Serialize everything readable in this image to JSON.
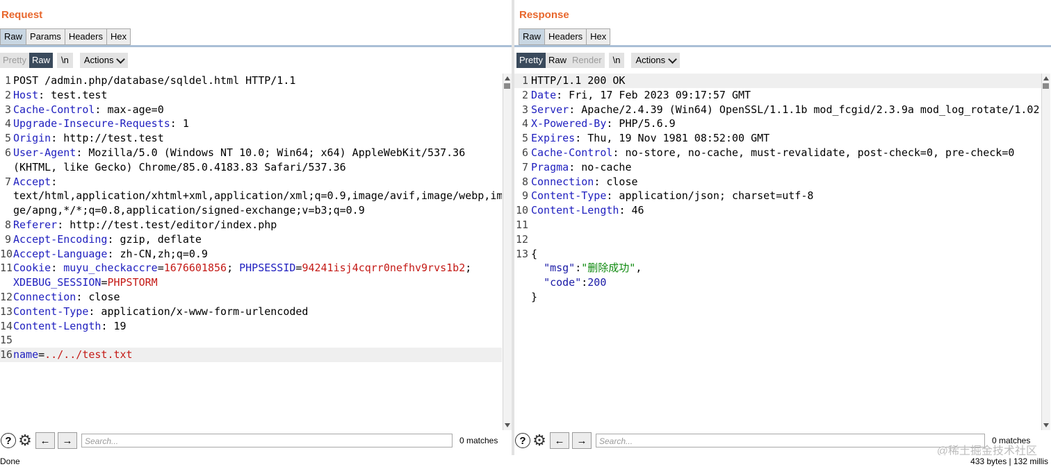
{
  "request": {
    "title": "Request",
    "tabs": [
      "Raw",
      "Params",
      "Headers",
      "Hex"
    ],
    "toolbar": {
      "pretty": "Pretty",
      "raw": "Raw",
      "newline": "\\n",
      "actions": "Actions"
    },
    "search": {
      "placeholder": "Search...",
      "matches": "0 matches"
    }
  },
  "response": {
    "title": "Response",
    "tabs": [
      "Raw",
      "Headers",
      "Hex"
    ],
    "toolbar": {
      "pretty": "Pretty",
      "raw": "Raw",
      "render": "Render",
      "newline": "\\n",
      "actions": "Actions"
    },
    "search": {
      "placeholder": "Search...",
      "matches": "0 matches"
    }
  },
  "status": {
    "left": "Done",
    "right": "433 bytes | 132 millis"
  },
  "watermark": "@稀土掘金技术社区",
  "icons": {
    "help": "help-icon",
    "settings": "gear-icon",
    "prev": "arrow-left-icon",
    "next": "arrow-right-icon"
  }
}
